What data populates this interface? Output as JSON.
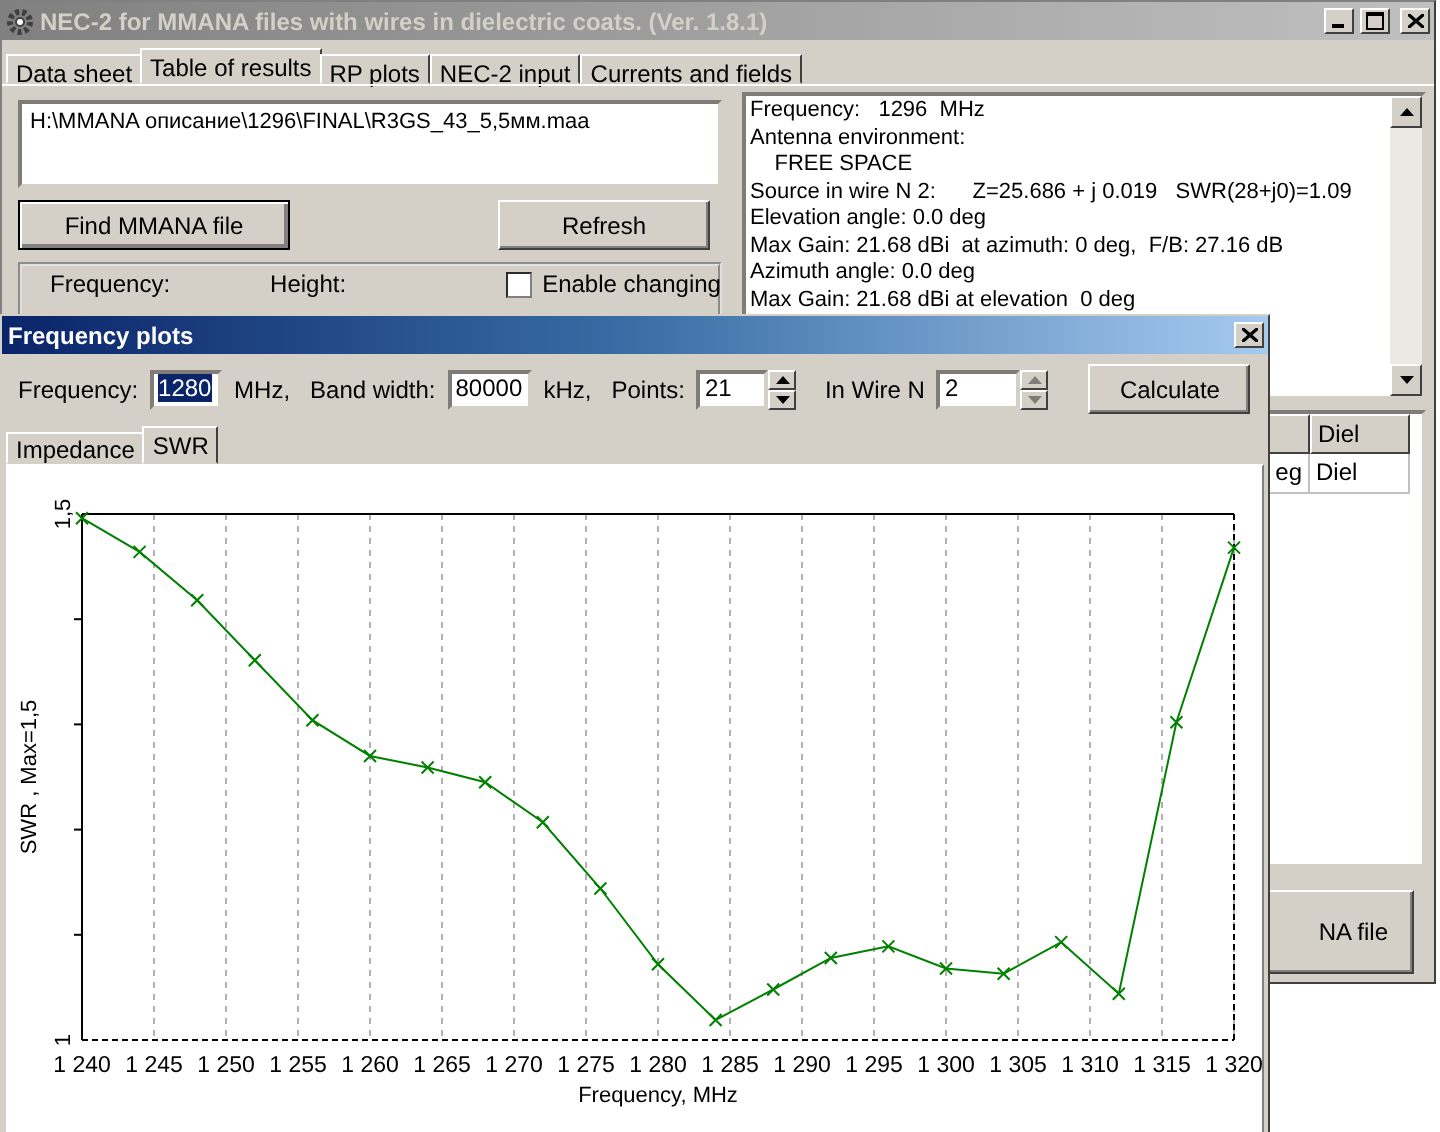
{
  "window": {
    "title": "NEC-2 for MMANA files with wires in dielectric coats. (Ver. 1.8.1)"
  },
  "tabs": [
    {
      "label": "Data sheet",
      "selected": false
    },
    {
      "label": "Table of results",
      "selected": true
    },
    {
      "label": "RP plots",
      "selected": false
    },
    {
      "label": "NEC-2 input",
      "selected": false
    },
    {
      "label": "Currents and fields",
      "selected": false
    }
  ],
  "file_path": "H:\\MMANA описание\\1296\\FINAL\\R3GS_43_5,5мм.maa",
  "buttons": {
    "find": "Find MMANA file",
    "refresh": "Refresh"
  },
  "group": {
    "frequency_label": "Frequency:",
    "height_label": "Height:",
    "enable_changing": {
      "label": "Enable changing",
      "checked": false
    }
  },
  "results_text": [
    "Frequency:   1296  MHz",
    "Antenna environment:",
    "    FREE SPACE",
    "Source in wire N 2:      Z=25.686 + j 0.019   SWR(28+j0)=1.09",
    "Elevation angle: 0.0 deg",
    "Max Gain: 21.68 dBi  at azimuth: 0 deg,  F/B: 27.16 dB",
    "Azimuth angle: 0.0 deg",
    "Max Gain: 21.68 dBi at elevation  0 deg"
  ],
  "table": {
    "columns": [
      "",
      "Diel"
    ],
    "rows": [
      [
        "eg",
        "Diel"
      ]
    ]
  },
  "bottom_button": "NA file",
  "dialog": {
    "title": "Frequency plots",
    "fields": [
      {
        "label": "Frequency:",
        "value": "1280",
        "unit": "MHz,",
        "selected": true
      },
      {
        "label": "Band width:",
        "value": "80000",
        "unit": "kHz,",
        "selected": false
      }
    ],
    "points": {
      "label": "Points:",
      "value": "21"
    },
    "wire": {
      "label": "In Wire N",
      "value": "2",
      "disabled": true
    },
    "calculate": "Calculate",
    "tabs": [
      {
        "label": "Impedance",
        "selected": false
      },
      {
        "label": "SWR",
        "selected": true
      }
    ],
    "chart_data": {
      "type": "line",
      "xlabel": "Frequency, MHz",
      "ylabel": "SWR ,  Max=1,5",
      "x": [
        1240,
        1244,
        1248,
        1252,
        1256,
        1260,
        1264,
        1268,
        1272,
        1276,
        1280,
        1284,
        1288,
        1292,
        1296,
        1300,
        1304,
        1308,
        1312,
        1316,
        1320
      ],
      "grid": true,
      "series": [
        {
          "color": "#008000",
          "marker": "x",
          "values": [
            1.496,
            1.464,
            1.418,
            1.361,
            1.304,
            1.27,
            1.259,
            1.245,
            1.207,
            1.144,
            1.072,
            1.019,
            1.048,
            1.078,
            1.089,
            1.068,
            1.063,
            1.093,
            1.044,
            1.302,
            1.468
          ]
        }
      ],
      "xlim": [
        1240,
        1320
      ],
      "ylim": [
        1,
        1.5
      ],
      "xticks": [
        {
          "value": 1240,
          "label": "1 240"
        },
        {
          "value": 1245,
          "label": "1 245"
        },
        {
          "value": 1250,
          "label": "1 250"
        },
        {
          "value": 1255,
          "label": "1 255"
        },
        {
          "value": 1260,
          "label": "1 260"
        },
        {
          "value": 1265,
          "label": "1 265"
        },
        {
          "value": 1270,
          "label": "1 270"
        },
        {
          "value": 1275,
          "label": "1 275"
        },
        {
          "value": 1280,
          "label": "1 280"
        },
        {
          "value": 1285,
          "label": "1 285"
        },
        {
          "value": 1290,
          "label": "1 290"
        },
        {
          "value": 1295,
          "label": "1 295"
        },
        {
          "value": 1300,
          "label": "1 300"
        },
        {
          "value": 1305,
          "label": "1 305"
        },
        {
          "value": 1310,
          "label": "1 310"
        },
        {
          "value": 1315,
          "label": "1 315"
        },
        {
          "value": 1320,
          "label": "1 320"
        }
      ],
      "yticks": [
        {
          "value": 1,
          "label": "1"
        },
        {
          "value": 1.5,
          "label": "1,5"
        }
      ]
    }
  }
}
